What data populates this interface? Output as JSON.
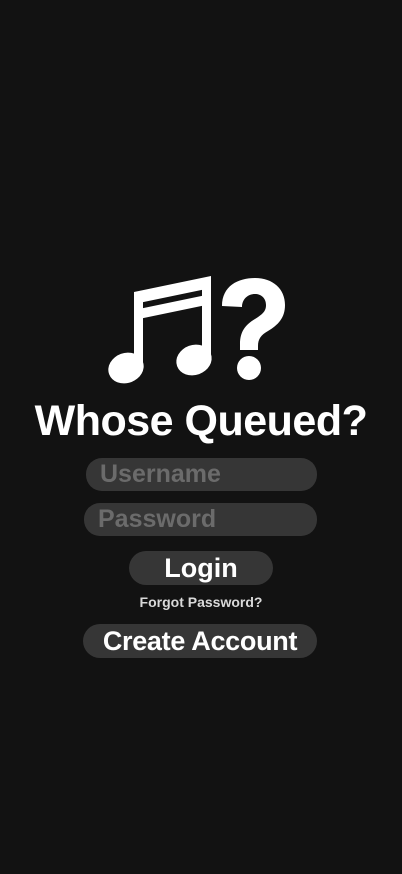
{
  "app": {
    "title": "Whose Queued?",
    "logo_icon": "music-notes-question-icon"
  },
  "form": {
    "username_placeholder": "Username",
    "username_value": "",
    "password_placeholder": "Password",
    "password_value": "",
    "login_label": "Login",
    "forgot_password_label": "Forgot Password?",
    "create_account_label": "Create Account"
  },
  "colors": {
    "background": "#121212",
    "field_background": "#363636",
    "placeholder_text": "#6b6b6b",
    "primary_text": "#ffffff",
    "secondary_text": "#d9d9d9"
  }
}
